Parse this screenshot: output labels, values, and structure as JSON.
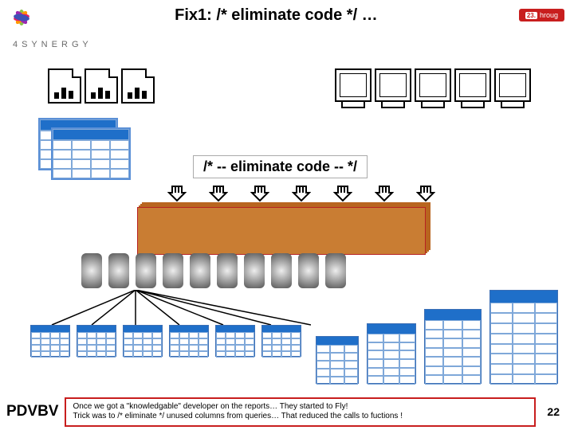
{
  "header": {
    "title": "Fix1: /* eliminate code */ …",
    "synergy": "4 S Y N E R G Y",
    "hroug": "hroug"
  },
  "center": {
    "eliminate": "/*  --  eliminate code  --  */"
  },
  "footer": {
    "pdvbv": "PDVBV",
    "notes_line1": "Once we got a \"knowledgable\" developer on the reports… They started to Fly!",
    "notes_line2": "Trick was to /* eliminate */ unused columns from queries… That reduced the calls to fuctions !",
    "page": "22"
  }
}
